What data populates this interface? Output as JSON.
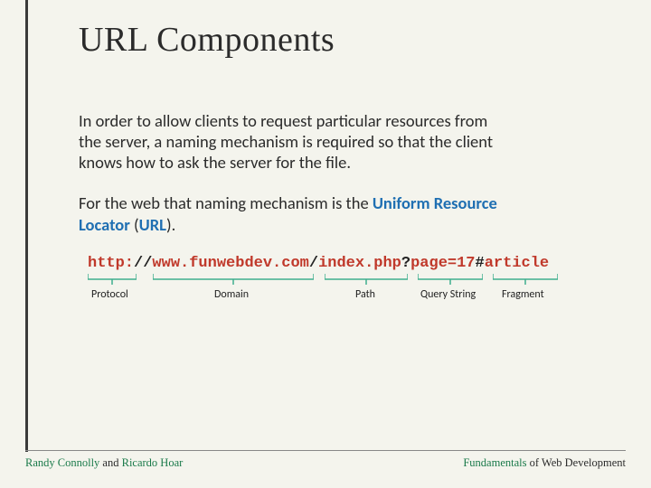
{
  "title": "URL Components",
  "para1": "In order to allow clients to request particular resources from the server, a naming mechanism is required so that the client knows how to ask the server for the file.",
  "para2_prefix": "For the web that naming mechanism is the ",
  "para2_highlight": "Uniform Resource Locator",
  "para2_open": " (",
  "para2_abbr": "URL",
  "para2_close": ").",
  "url": {
    "protocol": "http:",
    "sep1": "//",
    "domain": "www.funwebdev.com",
    "sep2": "/",
    "path": "index.php",
    "sep3": "?",
    "query": "page=17",
    "sep4": "#",
    "fragment": "article"
  },
  "labels": {
    "protocol": "Protocol",
    "domain": "Domain",
    "path": "Path",
    "query": "Query String",
    "fragment": "Fragment"
  },
  "footer": {
    "left_a": "Randy Connolly",
    "left_mid": " and ",
    "left_b": "Ricardo Hoar",
    "right_a": "Fundamentals",
    "right_b": " of Web Development"
  }
}
